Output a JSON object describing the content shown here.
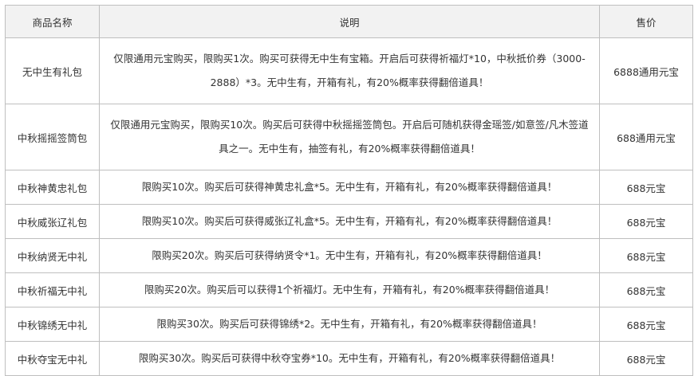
{
  "table": {
    "headers": {
      "name": "商品名称",
      "desc": "说明",
      "price": "售价"
    },
    "rows": [
      {
        "name": "无中生有礼包",
        "desc": "仅限通用元宝购买，限购买1次。购买可获得无中生有宝箱。开启后可获得祈福灯*10，中秋抵价券（3000-2888）*3。无中生有，开箱有礼，有20%概率获得翻倍道具！",
        "price": "6888通用元宝"
      },
      {
        "name": "中秋摇摇签筒包",
        "desc": "仅限通用元宝购买，限购买10次。购买后可获得中秋摇摇签筒包。开启后可随机获得金瑶签/如意签/凡木签道具之一。无中生有，抽签有礼，有20%概率获得翻倍道具！",
        "price": "688通用元宝"
      },
      {
        "name": "中秋神黄忠礼包",
        "desc": "限购买10次。购买后可获得神黄忠礼盒*5。无中生有，开箱有礼，有20%概率获得翻倍道具！",
        "price": "688元宝"
      },
      {
        "name": "中秋威张辽礼包",
        "desc": "限购买10次。购买后可获得威张辽礼盒*5。无中生有，开箱有礼，有20%概率获得翻倍道具！",
        "price": "688元宝"
      },
      {
        "name": "中秋纳贤无中礼",
        "desc": "限购买20次。购买后可获得纳贤令*1。无中生有，开箱有礼，有20%概率获得翻倍道具！",
        "price": "688元宝"
      },
      {
        "name": "中秋祈福无中礼",
        "desc": "限购买20次。购买后可以获得1个祈福灯。无中生有，开箱有礼，有20%概率获得翻倍道具！",
        "price": "688元宝"
      },
      {
        "name": "中秋锦绣无中礼",
        "desc": "限购买30次。购买后可获得锦绣*2。无中生有，开箱有礼，有20%概率获得翻倍道具！",
        "price": "688元宝"
      },
      {
        "name": "中秋夺宝无中礼",
        "desc": "限购买30次。购买后可获得中秋夺宝券*10。无中生有，开箱有礼，有20%概率获得翻倍道具！",
        "price": "688元宝"
      }
    ]
  }
}
